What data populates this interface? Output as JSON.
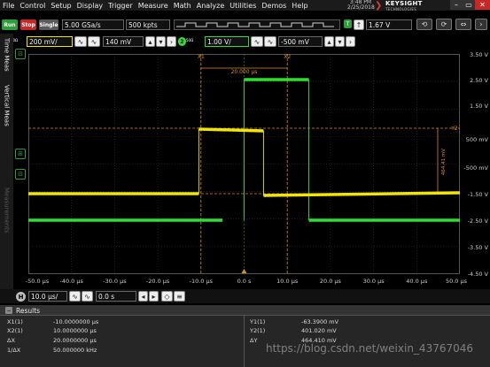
{
  "menu": [
    "File",
    "Control",
    "Setup",
    "Display",
    "Trigger",
    "Measure",
    "Math",
    "Analyze",
    "Utilities",
    "Demos",
    "Help"
  ],
  "datetime": {
    "time": "3:48 PM",
    "date": "2/25/2018"
  },
  "logo": {
    "name": "KEYSIGHT",
    "sub": "TECHNOLOGIES"
  },
  "toolbar": {
    "run": "Run",
    "stop": "Stop",
    "single": "Single",
    "sample_rate": "5.00 GSa/s",
    "memory": "500 kpts",
    "trigger_level": "1.67 V"
  },
  "channel1": {
    "num": "1",
    "sub": "50Ω",
    "scale": "200 mV/",
    "offset": "140 mV",
    "color": "#f2e600"
  },
  "channel2": {
    "num": "2",
    "sub": "50Ω",
    "scale": "1.00 V/",
    "offset": "-500 mV",
    "color": "#2ee02e"
  },
  "left_tabs": [
    "Time Meas",
    "Vertical Meas",
    "Measurements"
  ],
  "y_labels": [
    "3.50 V",
    "2.50 V",
    "1.50 V",
    "500 mV",
    "-500 mV",
    "-1.50 V",
    "-2.50 V",
    "-3.50 V",
    "-4.50 V"
  ],
  "x_labels": [
    "-50.0 μs",
    "-40.0 μs",
    "-30.0 μs",
    "-20.0 μs",
    "-10.0 μs",
    "0.0 s",
    "10.0 μs",
    "20.0 μs",
    "30.0 μs",
    "40.0 μs",
    "50.0 μs"
  ],
  "markers": {
    "x1": "X1",
    "x2": "X2",
    "y2": "Y2",
    "dx": "20.000 μs",
    "dy": "464.41 mV"
  },
  "horizontal": {
    "label": "H",
    "scale": "10.0 μs/",
    "position": "0.0 s"
  },
  "results": {
    "title": "Results",
    "left": [
      {
        "label": "X1(1)",
        "value": "-10.0000000 μs"
      },
      {
        "label": "X2(1)",
        "value": "10.0000000 μs"
      },
      {
        "label": "ΔX",
        "value": "20.0000000 μs"
      },
      {
        "label": "1/ΔX",
        "value": "50.000000 kHz"
      }
    ],
    "right": [
      {
        "label": "Y1(1)",
        "value": "-63.3900 mV"
      },
      {
        "label": "Y2(1)",
        "value": "401.020 mV"
      },
      {
        "label": "ΔY",
        "value": "464.410 mV"
      },
      {
        "label": "",
        "value": ""
      }
    ]
  },
  "watermark": "https://blog.csdn.net/weixin_43767046",
  "colors": {
    "ch1": "#f2e600",
    "ch2": "#2ee02e",
    "marker": "#e08a2a",
    "grid": "#3a3a3a"
  }
}
